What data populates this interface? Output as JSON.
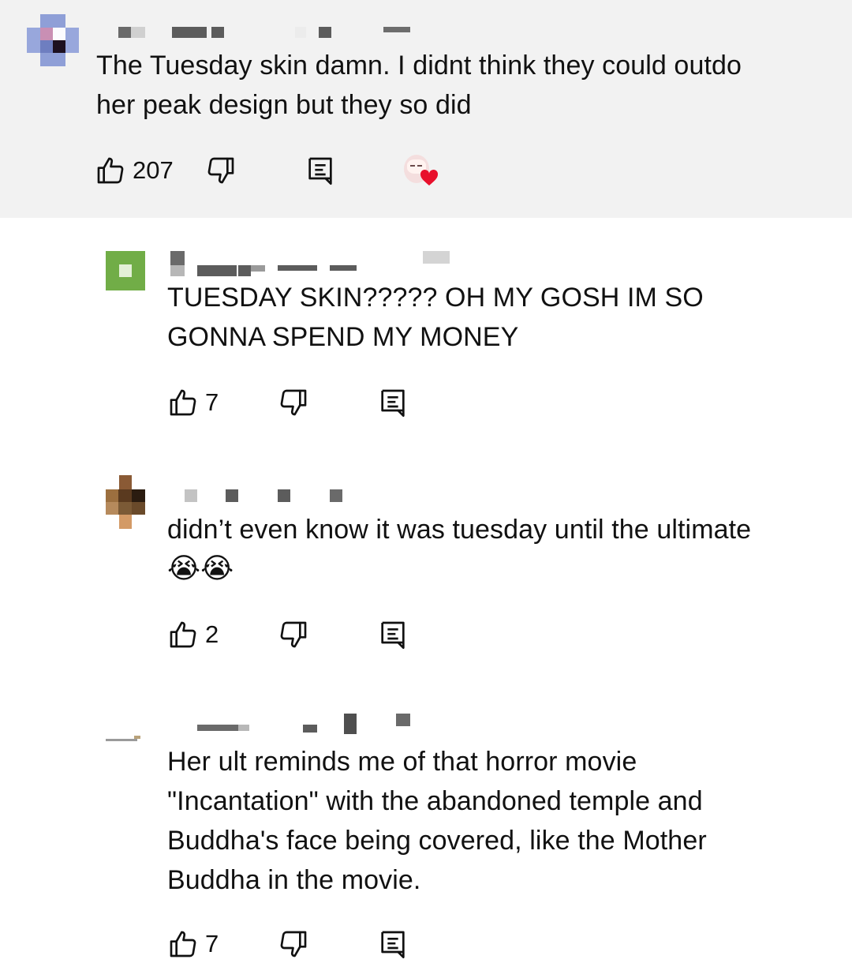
{
  "comments": [
    {
      "text_line1": "The Tuesday skin damn. I didnt think they could outdo",
      "text_line2": "her peak design but they so did",
      "likes": "207",
      "highlighted": true
    },
    {
      "text_line1": "TUESDAY SKIN????? OH MY GOSH IM SO",
      "text_line2": "GONNA SPEND MY MONEY",
      "likes": "7"
    },
    {
      "text_line1": "didn’t even know it was tuesday until the ultimate",
      "emoji": "😭😭",
      "likes": "2"
    },
    {
      "text_line1": "Her ult reminds me of that horror movie",
      "text_line2": "\"Incantation\" with the abandoned temple and",
      "text_line3": "Buddha's face being covered, like the Mother",
      "text_line4": "Buddha in the movie.",
      "likes": "7"
    }
  ],
  "icons": {
    "like": "thumbs-up-icon",
    "dislike": "thumbs-down-icon",
    "reply": "reply-icon",
    "creator_heart": "creator-heart-icon"
  },
  "colors": {
    "highlight_bg": "#f2f2f2",
    "text": "#0f0f0f",
    "heart": "#e8102c"
  }
}
